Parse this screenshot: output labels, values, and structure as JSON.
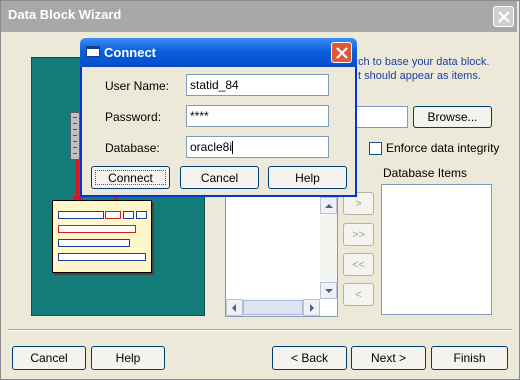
{
  "wizard": {
    "title": "Data Block Wizard",
    "hint_line1": "ch to base your data block.",
    "hint_line2": "t should appear as items.",
    "browse_label": "Browse...",
    "enforce_label": "Enforce data integrity",
    "enforce_checked": false,
    "database_items_label": "Database Items",
    "move_buttons": [
      ">",
      ">>",
      "<<",
      "<"
    ],
    "cancel_label": "Cancel",
    "help_label": "Help",
    "back_label": "< Back",
    "next_label": "Next >",
    "finish_label": "Finish"
  },
  "connect_dialog": {
    "title": "Connect",
    "user_name_label": "User Name:",
    "user_name_value": "statid_84",
    "password_label": "Password:",
    "password_value": "****",
    "database_label": "Database:",
    "database_value": "oracle8i",
    "connect_label": "Connect",
    "cancel_label": "Cancel",
    "help_label": "Help"
  },
  "colors": {
    "dialog_title_blue": "#0554d4",
    "close_red": "#e0583a",
    "artwork_teal": "#137b78",
    "window_face": "#ece9d8"
  }
}
